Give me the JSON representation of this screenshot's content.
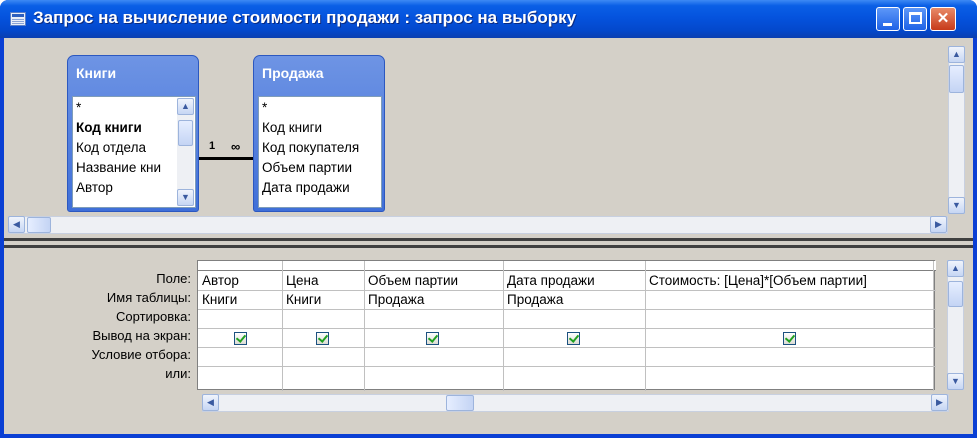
{
  "window": {
    "title": "Запрос на вычисление стоимости продажи : запрос на выборку",
    "min_glyph": "",
    "max_glyph": "",
    "close_glyph": "✕"
  },
  "tables": [
    {
      "name": "Книги",
      "fields": [
        "*",
        "Код книги",
        "Код отдела",
        "Название кни",
        "Автор"
      ],
      "key_field_index": 1
    },
    {
      "name": "Продажа",
      "fields": [
        "*",
        "Код книги",
        "Код покупателя",
        "Объем партии",
        "Дата продажи"
      ],
      "key_field_index": -1
    }
  ],
  "relationship": {
    "one_label": "1",
    "many_label": "∞"
  },
  "grid": {
    "row_labels": [
      "Поле:",
      "Имя таблицы:",
      "Сортировка:",
      "Вывод на экран:",
      "Условие отбора:",
      "или:"
    ],
    "columns": [
      {
        "field": "Автор",
        "table": "Книги",
        "show": true
      },
      {
        "field": "Цена",
        "table": "Книги",
        "show": true
      },
      {
        "field": "Объем партии",
        "table": "Продажа",
        "show": true
      },
      {
        "field": "Дата продажи",
        "table": "Продажа",
        "show": true
      },
      {
        "field": "Стоимость: [Цена]*[Объем партии]",
        "table": "",
        "show": true
      }
    ]
  },
  "scroll": {
    "up": "▲",
    "down": "▼",
    "left": "◀",
    "right": "▶"
  }
}
